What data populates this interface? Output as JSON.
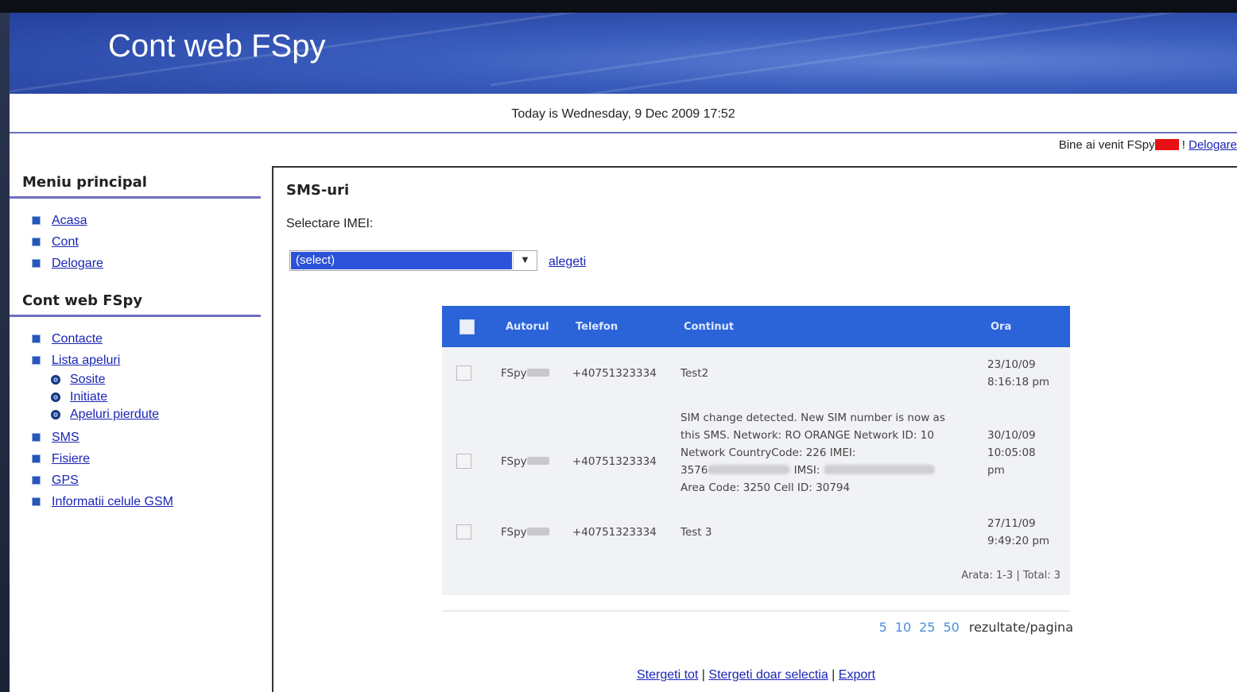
{
  "header": {
    "title": "Cont web FSpy",
    "date_text": "Today is Wednesday, 9 Dec 2009 17:52"
  },
  "welcome": {
    "text": "Bine ai venit FSpy",
    "suffix": " ! ",
    "logout": "Delogare"
  },
  "sidebar": {
    "section1_title": "Meniu principal",
    "section1_items": [
      "Acasa",
      "Cont",
      "Delogare"
    ],
    "section2_title": "Cont web FSpy",
    "contacte": "Contacte",
    "lista_apeluri": "Lista apeluri",
    "sub_items": [
      "Sosite",
      "Initiate",
      "Apeluri pierdute"
    ],
    "more_items": [
      "SMS",
      "Fisiere",
      "GPS",
      "Informatii celule GSM"
    ]
  },
  "main": {
    "title": "SMS-uri",
    "imei_label": "Selectare IMEI:",
    "select_value": "(select)",
    "alegeti": "alegeti",
    "columns": [
      "Autorul",
      "Telefon",
      "Continut",
      "Ora"
    ],
    "rows": [
      {
        "autor": "FSpy",
        "telefon": "+40751323334",
        "continut": [
          "Test2"
        ],
        "ora": [
          "23/10/09",
          "8:16:18 pm"
        ]
      },
      {
        "autor": "FSpy",
        "telefon": "+40751323334",
        "continut": [
          "SIM change detected. New SIM number is now as",
          "this SMS. Network: RO ORANGE Network ID: 10",
          "Network CountryCode: 226 IMEI:",
          "3576",
          "IMSI:",
          "Area Code: 3250 Cell ID: 30794"
        ],
        "ora": [
          "30/10/09",
          "10:05:08",
          "pm"
        ]
      },
      {
        "autor": "FSpy",
        "telefon": "+40751323334",
        "continut": [
          "Test 3"
        ],
        "ora": [
          "27/11/09",
          "9:49:20 pm"
        ]
      }
    ],
    "total_text": "Arata: 1-3 | Total: 3",
    "page_sizes": [
      "5",
      "10",
      "25",
      "50"
    ],
    "page_label": "rezultate/pagina",
    "actions": [
      "Stergeti tot",
      "Stergeti doar selectia",
      "Export"
    ]
  },
  "colors": {
    "banner": "#2f4fb0",
    "table_header": "#2b63d8",
    "link": "#1a25b5",
    "redaction": "#e81010"
  }
}
